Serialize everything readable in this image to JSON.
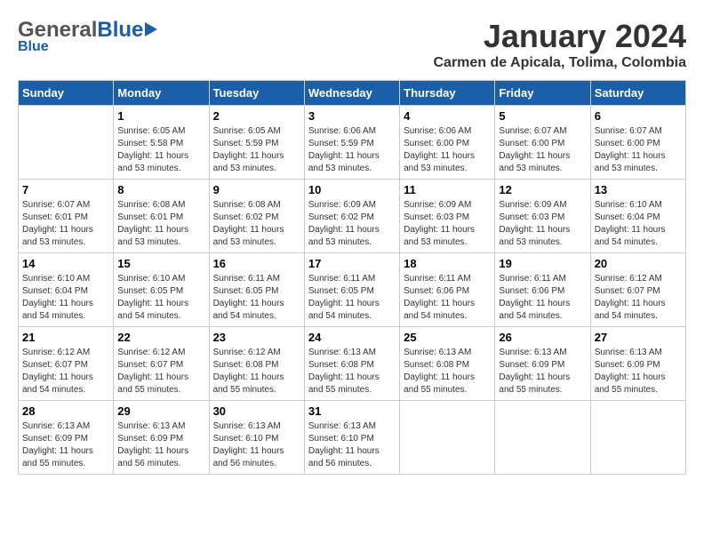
{
  "header": {
    "logo": {
      "general": "General",
      "blue": "Blue"
    },
    "title": "January 2024",
    "subtitle": "Carmen de Apicala, Tolima, Colombia"
  },
  "calendar": {
    "weekdays": [
      "Sunday",
      "Monday",
      "Tuesday",
      "Wednesday",
      "Thursday",
      "Friday",
      "Saturday"
    ],
    "weeks": [
      [
        {
          "day": "",
          "sunrise": "",
          "sunset": "",
          "daylight": ""
        },
        {
          "day": "1",
          "sunrise": "Sunrise: 6:05 AM",
          "sunset": "Sunset: 5:58 PM",
          "daylight": "Daylight: 11 hours and 53 minutes."
        },
        {
          "day": "2",
          "sunrise": "Sunrise: 6:05 AM",
          "sunset": "Sunset: 5:59 PM",
          "daylight": "Daylight: 11 hours and 53 minutes."
        },
        {
          "day": "3",
          "sunrise": "Sunrise: 6:06 AM",
          "sunset": "Sunset: 5:59 PM",
          "daylight": "Daylight: 11 hours and 53 minutes."
        },
        {
          "day": "4",
          "sunrise": "Sunrise: 6:06 AM",
          "sunset": "Sunset: 6:00 PM",
          "daylight": "Daylight: 11 hours and 53 minutes."
        },
        {
          "day": "5",
          "sunrise": "Sunrise: 6:07 AM",
          "sunset": "Sunset: 6:00 PM",
          "daylight": "Daylight: 11 hours and 53 minutes."
        },
        {
          "day": "6",
          "sunrise": "Sunrise: 6:07 AM",
          "sunset": "Sunset: 6:00 PM",
          "daylight": "Daylight: 11 hours and 53 minutes."
        }
      ],
      [
        {
          "day": "7",
          "sunrise": "Sunrise: 6:07 AM",
          "sunset": "Sunset: 6:01 PM",
          "daylight": "Daylight: 11 hours and 53 minutes."
        },
        {
          "day": "8",
          "sunrise": "Sunrise: 6:08 AM",
          "sunset": "Sunset: 6:01 PM",
          "daylight": "Daylight: 11 hours and 53 minutes."
        },
        {
          "day": "9",
          "sunrise": "Sunrise: 6:08 AM",
          "sunset": "Sunset: 6:02 PM",
          "daylight": "Daylight: 11 hours and 53 minutes."
        },
        {
          "day": "10",
          "sunrise": "Sunrise: 6:09 AM",
          "sunset": "Sunset: 6:02 PM",
          "daylight": "Daylight: 11 hours and 53 minutes."
        },
        {
          "day": "11",
          "sunrise": "Sunrise: 6:09 AM",
          "sunset": "Sunset: 6:03 PM",
          "daylight": "Daylight: 11 hours and 53 minutes."
        },
        {
          "day": "12",
          "sunrise": "Sunrise: 6:09 AM",
          "sunset": "Sunset: 6:03 PM",
          "daylight": "Daylight: 11 hours and 53 minutes."
        },
        {
          "day": "13",
          "sunrise": "Sunrise: 6:10 AM",
          "sunset": "Sunset: 6:04 PM",
          "daylight": "Daylight: 11 hours and 54 minutes."
        }
      ],
      [
        {
          "day": "14",
          "sunrise": "Sunrise: 6:10 AM",
          "sunset": "Sunset: 6:04 PM",
          "daylight": "Daylight: 11 hours and 54 minutes."
        },
        {
          "day": "15",
          "sunrise": "Sunrise: 6:10 AM",
          "sunset": "Sunset: 6:05 PM",
          "daylight": "Daylight: 11 hours and 54 minutes."
        },
        {
          "day": "16",
          "sunrise": "Sunrise: 6:11 AM",
          "sunset": "Sunset: 6:05 PM",
          "daylight": "Daylight: 11 hours and 54 minutes."
        },
        {
          "day": "17",
          "sunrise": "Sunrise: 6:11 AM",
          "sunset": "Sunset: 6:05 PM",
          "daylight": "Daylight: 11 hours and 54 minutes."
        },
        {
          "day": "18",
          "sunrise": "Sunrise: 6:11 AM",
          "sunset": "Sunset: 6:06 PM",
          "daylight": "Daylight: 11 hours and 54 minutes."
        },
        {
          "day": "19",
          "sunrise": "Sunrise: 6:11 AM",
          "sunset": "Sunset: 6:06 PM",
          "daylight": "Daylight: 11 hours and 54 minutes."
        },
        {
          "day": "20",
          "sunrise": "Sunrise: 6:12 AM",
          "sunset": "Sunset: 6:07 PM",
          "daylight": "Daylight: 11 hours and 54 minutes."
        }
      ],
      [
        {
          "day": "21",
          "sunrise": "Sunrise: 6:12 AM",
          "sunset": "Sunset: 6:07 PM",
          "daylight": "Daylight: 11 hours and 54 minutes."
        },
        {
          "day": "22",
          "sunrise": "Sunrise: 6:12 AM",
          "sunset": "Sunset: 6:07 PM",
          "daylight": "Daylight: 11 hours and 55 minutes."
        },
        {
          "day": "23",
          "sunrise": "Sunrise: 6:12 AM",
          "sunset": "Sunset: 6:08 PM",
          "daylight": "Daylight: 11 hours and 55 minutes."
        },
        {
          "day": "24",
          "sunrise": "Sunrise: 6:13 AM",
          "sunset": "Sunset: 6:08 PM",
          "daylight": "Daylight: 11 hours and 55 minutes."
        },
        {
          "day": "25",
          "sunrise": "Sunrise: 6:13 AM",
          "sunset": "Sunset: 6:08 PM",
          "daylight": "Daylight: 11 hours and 55 minutes."
        },
        {
          "day": "26",
          "sunrise": "Sunrise: 6:13 AM",
          "sunset": "Sunset: 6:09 PM",
          "daylight": "Daylight: 11 hours and 55 minutes."
        },
        {
          "day": "27",
          "sunrise": "Sunrise: 6:13 AM",
          "sunset": "Sunset: 6:09 PM",
          "daylight": "Daylight: 11 hours and 55 minutes."
        }
      ],
      [
        {
          "day": "28",
          "sunrise": "Sunrise: 6:13 AM",
          "sunset": "Sunset: 6:09 PM",
          "daylight": "Daylight: 11 hours and 55 minutes."
        },
        {
          "day": "29",
          "sunrise": "Sunrise: 6:13 AM",
          "sunset": "Sunset: 6:09 PM",
          "daylight": "Daylight: 11 hours and 56 minutes."
        },
        {
          "day": "30",
          "sunrise": "Sunrise: 6:13 AM",
          "sunset": "Sunset: 6:10 PM",
          "daylight": "Daylight: 11 hours and 56 minutes."
        },
        {
          "day": "31",
          "sunrise": "Sunrise: 6:13 AM",
          "sunset": "Sunset: 6:10 PM",
          "daylight": "Daylight: 11 hours and 56 minutes."
        },
        {
          "day": "",
          "sunrise": "",
          "sunset": "",
          "daylight": ""
        },
        {
          "day": "",
          "sunrise": "",
          "sunset": "",
          "daylight": ""
        },
        {
          "day": "",
          "sunrise": "",
          "sunset": "",
          "daylight": ""
        }
      ]
    ]
  }
}
